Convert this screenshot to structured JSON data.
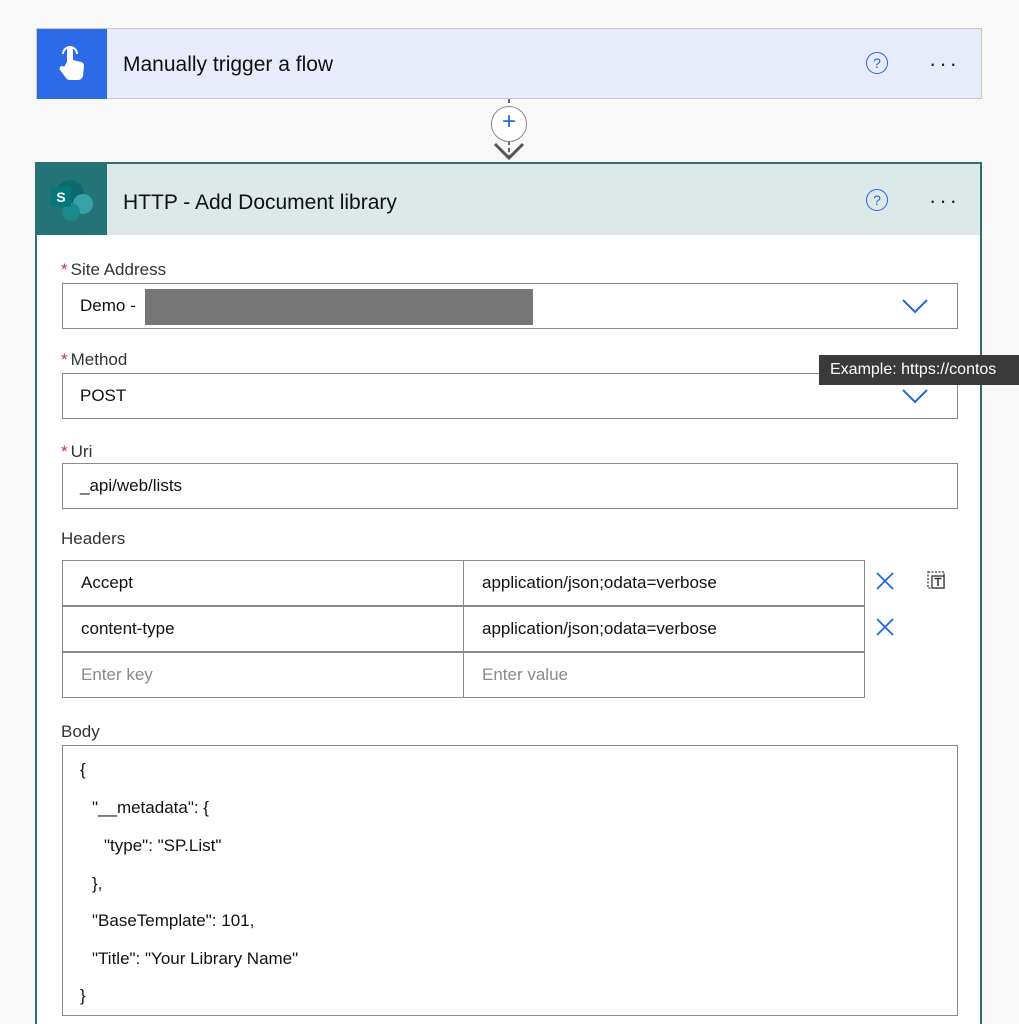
{
  "trigger": {
    "title": "Manually trigger a flow",
    "help": "?",
    "more": "···"
  },
  "connector": {
    "plus": "+"
  },
  "action": {
    "title": "HTTP - Add Document library",
    "help": "?",
    "more": "···",
    "site_address": {
      "label": "Site Address",
      "value": "Demo -"
    },
    "method": {
      "label": "Method",
      "value": "POST"
    },
    "uri": {
      "label": "Uri",
      "value": "_api/web/lists"
    },
    "tooltip": "Example: https://contos",
    "headers": {
      "label": "Headers",
      "rows": [
        {
          "key": "Accept",
          "value": "application/json;odata=verbose"
        },
        {
          "key": "content-type",
          "value": "application/json;odata=verbose"
        }
      ],
      "key_placeholder": "Enter key",
      "value_placeholder": "Enter value"
    },
    "body": {
      "label": "Body",
      "lines": [
        "{",
        "\"__metadata\": {",
        "\"type\": \"SP.List\"",
        "},",
        "\"BaseTemplate\": 101,",
        "\"Title\": \"Your Library Name\"",
        "}"
      ]
    },
    "required_mark": "*"
  },
  "colors": {
    "trigger_blue": "#2b6be8",
    "sharepoint_teal": "#237377",
    "accent": "#2266e3",
    "required": "#c4314b"
  }
}
